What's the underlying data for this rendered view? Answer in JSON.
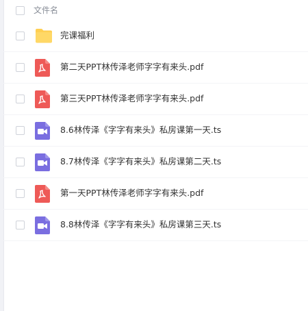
{
  "header": {
    "column_label": "文件名"
  },
  "colors": {
    "folder": "#ffcf52",
    "pdf": "#ee5a57",
    "video": "#7a6ee0"
  },
  "files": [
    {
      "name": "完课福利",
      "icon": "folder-icon"
    },
    {
      "name": "第二天PPT林传泽老师字字有来头.pdf",
      "icon": "pdf-icon"
    },
    {
      "name": "第三天PPT林传泽老师字字有来头.pdf",
      "icon": "pdf-icon"
    },
    {
      "name": "8.6林传泽《字字有来头》私房课第一天.ts",
      "icon": "video-icon"
    },
    {
      "name": "8.7林传泽《字字有来头》私房课第二天.ts",
      "icon": "video-icon"
    },
    {
      "name": "第一天PPT林传泽老师字字有来头.pdf",
      "icon": "pdf-icon"
    },
    {
      "name": "8.8林传泽《字字有来头》私房课第三天.ts",
      "icon": "video-icon"
    }
  ]
}
